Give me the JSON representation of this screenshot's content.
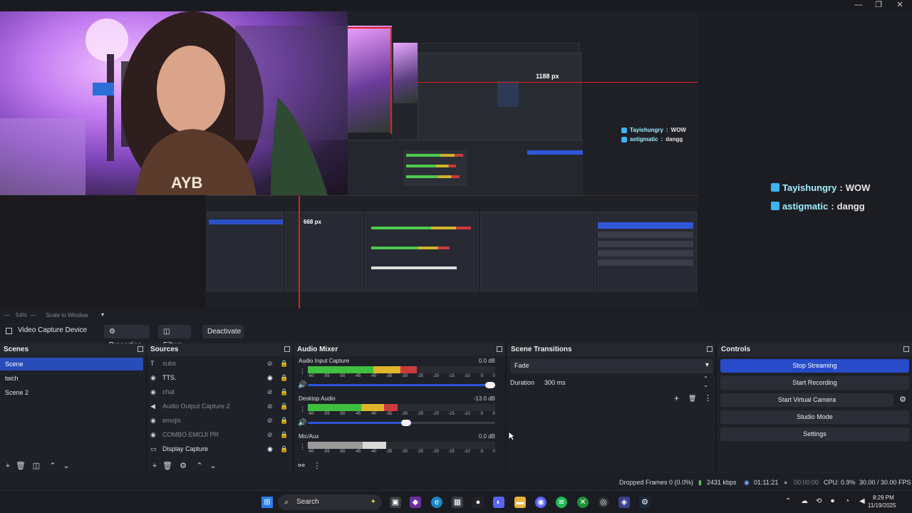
{
  "window": {
    "minimize": "—",
    "restore": "❐",
    "close": "✕"
  },
  "preview": {
    "measure_label_1": "1188 px",
    "measure_label_2": "668 px",
    "chat": [
      {
        "user": "Tayishungry",
        "message": "WOW"
      },
      {
        "user": "astigmatic",
        "message": "dangg"
      }
    ],
    "inner_chat": [
      {
        "user": "Tayishungry",
        "message": "WOW"
      },
      {
        "user": "astigmatic",
        "message": "dangg"
      }
    ]
  },
  "zoombar": {
    "zoom": "54%",
    "scale_mode": "Scale to Window"
  },
  "source_toolbar": {
    "source_name": "Video Capture Device",
    "properties": "Properties",
    "filters": "Filters",
    "deactivate": "Deactivate"
  },
  "scenes": {
    "title": "Scenes",
    "items": [
      "Scene",
      "twch",
      "Scene 2"
    ],
    "selected": "Scene"
  },
  "sources": {
    "title": "Sources",
    "items": [
      {
        "label": "subs",
        "icon": "text-icon",
        "visible": false
      },
      {
        "label": "TTS.",
        "icon": "browser-icon",
        "visible": true
      },
      {
        "label": "chat",
        "icon": "browser-icon",
        "visible": false
      },
      {
        "label": "Audio Output Capture 2",
        "icon": "speaker-icon",
        "visible": false
      },
      {
        "label": "emojis",
        "icon": "browser-icon",
        "visible": false
      },
      {
        "label": "COMBO EMOJI PR",
        "icon": "browser-icon",
        "visible": false
      },
      {
        "label": "Display Capture",
        "icon": "monitor-icon",
        "visible": true
      }
    ]
  },
  "mixer": {
    "title": "Audio Mixer",
    "scale": [
      "-60",
      "-55",
      "-50",
      "-45",
      "-40",
      "-35",
      "-30",
      "-25",
      "-20",
      "-15",
      "-10",
      "-5",
      "0"
    ],
    "channels": [
      {
        "name": "Audio Input Capture",
        "db": "0.0 dB",
        "level": 0.58,
        "volume": 1.0
      },
      {
        "name": "Desktop Audio",
        "db": "-13.0 dB",
        "level": 0.48,
        "volume": 0.55
      },
      {
        "name": "Mic/Aux",
        "db": "0.0 dB",
        "level": 0.42,
        "volume": 0.0
      }
    ]
  },
  "transitions": {
    "title": "Scene Transitions",
    "type": "Fade",
    "duration_label": "Duration",
    "duration_value": "300 ms"
  },
  "controls": {
    "title": "Controls",
    "stop_streaming": "Stop Streaming",
    "start_recording": "Start Recording",
    "start_virtual_camera": "Start Virtual Camera",
    "studio_mode": "Studio Mode",
    "settings": "Settings"
  },
  "status": {
    "dropped_frames": "Dropped Frames 0 (0.0%)",
    "bitrate": "2431 kbps",
    "stream_time": "01:11:21",
    "rec_time": "00:00:00",
    "cpu": "CPU: 0.9%",
    "fps": "30.00 / 30.00 FPS"
  },
  "taskbar": {
    "search_placeholder": "Search",
    "time": "8:29 PM",
    "date": "11/19/2025"
  },
  "colors": {
    "accent": "#284cb8",
    "meter_green": "#4fc94f",
    "meter_yellow": "#d0b32a",
    "meter_red": "#cc3b3b"
  }
}
